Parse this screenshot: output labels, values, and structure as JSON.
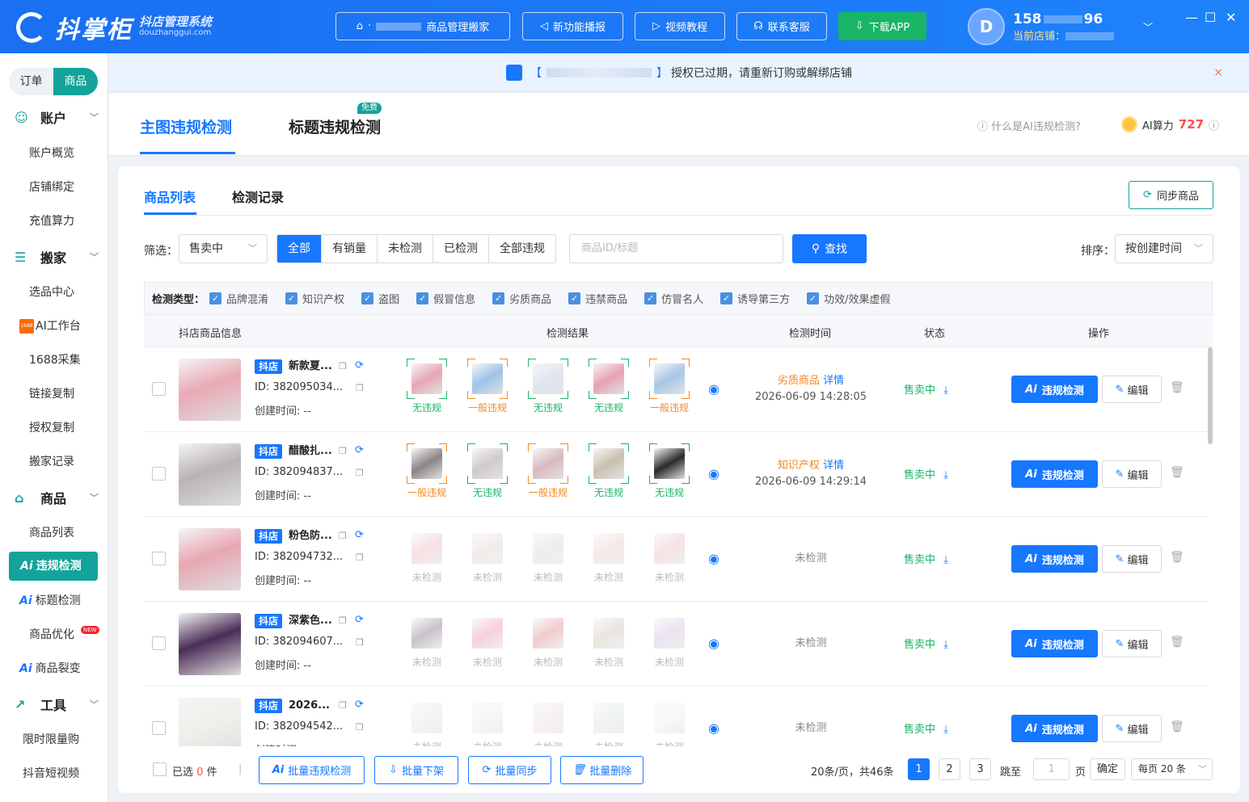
{
  "app": {
    "name": "抖掌柜",
    "subtitle": "抖店管理系统",
    "domain": "douzhanggui.com"
  },
  "topnav": {
    "items": [
      {
        "label": "商品管理搬家",
        "prefix": "· ",
        "icon": "briefcase-icon"
      },
      {
        "label": "新功能播报",
        "icon": "megaphone-icon"
      },
      {
        "label": "视频教程",
        "icon": "video-icon"
      },
      {
        "label": "联系客服",
        "icon": "headset-icon"
      },
      {
        "label": "下载APP",
        "icon": "download-icon"
      }
    ]
  },
  "user": {
    "phone": "158",
    "phone_end": "96",
    "store_label": "当前店铺：",
    "avatar_letter": "D"
  },
  "window": {
    "minimize": "—",
    "maximize": "☐",
    "close": "✕"
  },
  "sidebar": {
    "switch": {
      "order": "订单",
      "product": "商品"
    },
    "groups": [
      {
        "label": "账户",
        "icon": "account-icon",
        "items": [
          "账户概览",
          "店铺绑定",
          "充值算力"
        ]
      },
      {
        "label": "搬家",
        "icon": "move-icon",
        "items": [
          "选品中心",
          "AI工作台",
          "1688采集",
          "链接复制",
          "授权复制",
          "搬家记录"
        ]
      },
      {
        "label": "商品",
        "icon": "shop-icon",
        "items": [
          "商品列表",
          "违规检测",
          "标题检测",
          "商品优化",
          "商品裂变"
        ]
      },
      {
        "label": "工具",
        "icon": "chart-icon",
        "items": [
          "限时限量购",
          "抖音短视频"
        ]
      }
    ],
    "badge_new": "NEW",
    "ai_prefix": "Ai",
    "tag_1688": "1688"
  },
  "notice": {
    "bracket_open": "【",
    "bracket_close": "】",
    "text": "授权已过期，请重新订购或解绑店铺",
    "close": "×"
  },
  "header": {
    "tabs": [
      "主图违规检测",
      "标题违规检测"
    ],
    "free_badge": "免费",
    "what_is": "什么是AI违规检测?",
    "ai_power_label": "AI算力",
    "ai_power_value": "727"
  },
  "list": {
    "tabs": [
      "商品列表",
      "检测记录"
    ],
    "sync_label": "同步商品",
    "filter_label": "筛选：",
    "status_select": "售卖中",
    "segments": [
      "全部",
      "有销量",
      "未检测",
      "已检测",
      "全部违规"
    ],
    "search_placeholder": "商品ID/标题",
    "find_label": "查找",
    "sort_label": "排序：",
    "sort_select": "按创建时间",
    "types_label": "检测类型：",
    "types": [
      "品牌混淆",
      "知识产权",
      "盗图",
      "假冒信息",
      "劣质商品",
      "违禁商品",
      "仿冒名人",
      "诱导第三方",
      "功效/效果虚假"
    ],
    "columns": [
      "抖店商品信息",
      "检测结果",
      "检测时间",
      "状态",
      "操作"
    ]
  },
  "rows": [
    {
      "tag": "抖店",
      "name": "新款夏...",
      "id": "ID: 382095034...",
      "created": "创建时间: --",
      "img": "#e9a9b5",
      "thumbs": [
        {
          "c": "#e8a6b5",
          "cap": "无违规",
          "s": "ok"
        },
        {
          "c": "#9cc3e8",
          "cap": "一般违规",
          "s": "warn"
        },
        {
          "c": "#dfe6ef",
          "cap": "无违规",
          "s": "ok"
        },
        {
          "c": "#e7a1b2",
          "cap": "无违规",
          "s": "ok"
        },
        {
          "c": "#a7c7e6",
          "cap": "一般违规",
          "s": "warn"
        }
      ],
      "result_type": "劣质商品",
      "result_detail": "详情",
      "result_time": "2026-06-09 14:28:05",
      "status": "售卖中"
    },
    {
      "tag": "抖店",
      "name": "醋酸扎...",
      "id": "ID: 382094837...",
      "created": "创建时间: --",
      "img": "#b9b3b4",
      "thumbs": [
        {
          "c": "#8a8486",
          "cap": "一般违规",
          "s": "warn"
        },
        {
          "c": "#cfcbc9",
          "cap": "无违规",
          "s": "ok"
        },
        {
          "c": "#d8b9bd",
          "cap": "一般违规",
          "s": "warn"
        },
        {
          "c": "#c9bfae",
          "cap": "无违规",
          "s": "ok"
        },
        {
          "c": "#2b2b2b",
          "cap": "无违规",
          "s": "ok"
        }
      ],
      "result_type": "知识产权",
      "result_detail": "详情",
      "result_time": "2026-06-09 14:29:14",
      "status": "售卖中"
    },
    {
      "tag": "抖店",
      "name": "粉色防...",
      "id": "ID: 382094732...",
      "created": "创建时间: --",
      "img": "#e8a7b2",
      "thumbs": [
        {
          "c": "#f0c6cd",
          "cap": "未检测",
          "s": "none"
        },
        {
          "c": "#e8ddd6",
          "cap": "未检测",
          "s": "none"
        },
        {
          "c": "#dfe0e6",
          "cap": "未检测",
          "s": "none"
        },
        {
          "c": "#efd8d6",
          "cap": "未检测",
          "s": "none"
        },
        {
          "c": "#f1c9cd",
          "cap": "未检测",
          "s": "none"
        }
      ],
      "result_text": "未检测",
      "status": "售卖中"
    },
    {
      "tag": "抖店",
      "name": "深紫色...",
      "id": "ID: 382094607...",
      "created": "创建时间: --",
      "img": "#4b2d57",
      "thumbs": [
        {
          "c": "#9b8f9f",
          "cap": "未检测",
          "s": "none"
        },
        {
          "c": "#f2a7c4",
          "cap": "未检测",
          "s": "none"
        },
        {
          "c": "#e7a0a5",
          "cap": "未检测",
          "s": "none"
        },
        {
          "c": "#d6d0c3",
          "cap": "未检测",
          "s": "none"
        },
        {
          "c": "#d8cde5",
          "cap": "未检测",
          "s": "none"
        }
      ],
      "result_text": "未检测",
      "status": "售卖中"
    },
    {
      "tag": "抖店",
      "name": "2026...",
      "id": "ID: 382094542...",
      "created": "创建时间: --",
      "img": "#f1efea",
      "thumbs": [
        {
          "c": "#ecebe6",
          "cap": "未检测",
          "s": "none"
        },
        {
          "c": "#eef0f2",
          "cap": "未检测",
          "s": "none"
        },
        {
          "c": "#f2e6e6",
          "cap": "未检测",
          "s": "none"
        },
        {
          "c": "#e3ebe6",
          "cap": "未检测",
          "s": "none"
        },
        {
          "c": "#f4f4f4",
          "cap": "未检测",
          "s": "none"
        }
      ],
      "result_text": "未检测",
      "status": "售卖中"
    }
  ],
  "row_actions": {
    "check": "违规检测",
    "edit": "编辑"
  },
  "footer": {
    "selected_prefix": "已选",
    "selected_count": "0",
    "selected_suffix": "件",
    "sep": "|",
    "batch": [
      "批量违规检测",
      "批量下架",
      "批量同步",
      "批量删除"
    ],
    "page_info": "20条/页，共46条",
    "pages": [
      "1",
      "2",
      "3"
    ],
    "jump_label": "跳至",
    "jump_value": "1",
    "page_unit": "页",
    "confirm": "确定",
    "per_page": "每页 20 条"
  },
  "colors": {
    "brand": "#1677ff",
    "teal": "#13a39a",
    "green": "#18b566",
    "orange": "#f08a24",
    "red": "#ff4d4f"
  }
}
